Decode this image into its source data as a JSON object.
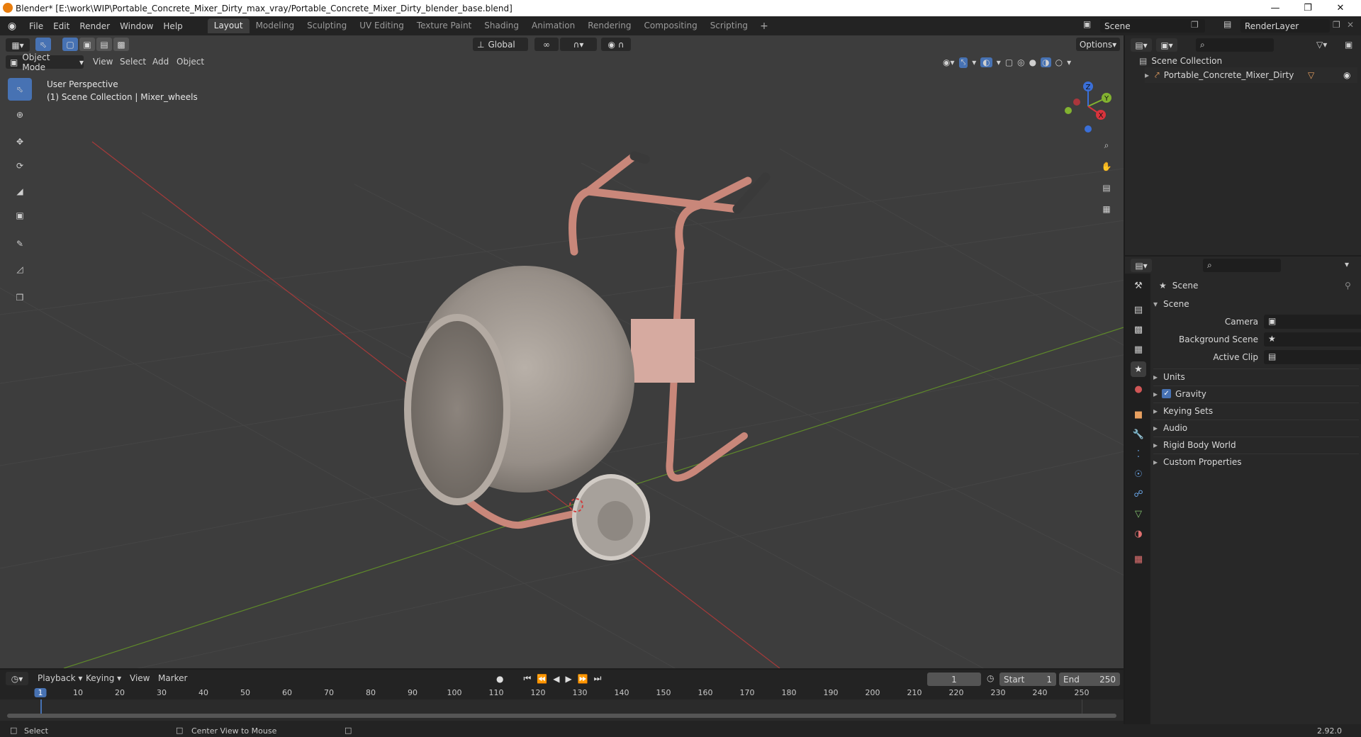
{
  "window": {
    "title": "Blender* [E:\\work\\WIP\\Portable_Concrete_Mixer_Dirty_max_vray/Portable_Concrete_Mixer_Dirty_blender_base.blend]"
  },
  "menu": [
    "File",
    "Edit",
    "Render",
    "Window",
    "Help"
  ],
  "workspaces": [
    {
      "label": "Layout",
      "active": true
    },
    {
      "label": "Modeling"
    },
    {
      "label": "Sculpting"
    },
    {
      "label": "UV Editing"
    },
    {
      "label": "Texture Paint"
    },
    {
      "label": "Shading"
    },
    {
      "label": "Animation"
    },
    {
      "label": "Rendering"
    },
    {
      "label": "Compositing"
    },
    {
      "label": "Scripting"
    }
  ],
  "scene_selector": "Scene",
  "view_layer": "RenderLayer",
  "viewport": {
    "transform_orientation": "Global",
    "options_label": "Options",
    "mode": "Object Mode",
    "menus": [
      "View",
      "Select",
      "Add",
      "Object"
    ],
    "overlay_line1": "User Perspective",
    "overlay_line2": "(1) Scene Collection | Mixer_wheels",
    "gizmo_labels": {
      "z": "Z",
      "y": "Y",
      "x": "X"
    }
  },
  "outliner": {
    "root": "Scene Collection",
    "items": [
      {
        "label": "Portable_Concrete_Mixer_Dirty"
      }
    ]
  },
  "properties": {
    "header": "Scene",
    "section": "Scene",
    "fields": [
      {
        "label": "Camera"
      },
      {
        "label": "Background Scene"
      },
      {
        "label": "Active Clip"
      }
    ],
    "panels": [
      {
        "label": "Units"
      },
      {
        "label": "Gravity",
        "checked": true
      },
      {
        "label": "Keying Sets"
      },
      {
        "label": "Audio"
      },
      {
        "label": "Rigid Body World"
      },
      {
        "label": "Custom Properties"
      }
    ]
  },
  "timeline": {
    "menus": [
      "Playback",
      "Keying",
      "View",
      "Marker"
    ],
    "current_frame": "1",
    "start_label": "Start",
    "start": "1",
    "end_label": "End",
    "end": "250",
    "ticks": [
      "1",
      "10",
      "20",
      "30",
      "40",
      "50",
      "60",
      "70",
      "80",
      "90",
      "100",
      "110",
      "120",
      "130",
      "140",
      "150",
      "160",
      "170",
      "180",
      "190",
      "200",
      "210",
      "220",
      "230",
      "240",
      "250"
    ]
  },
  "status": {
    "select": "Select",
    "center": "Center View to Mouse",
    "version": "2.92.0"
  }
}
